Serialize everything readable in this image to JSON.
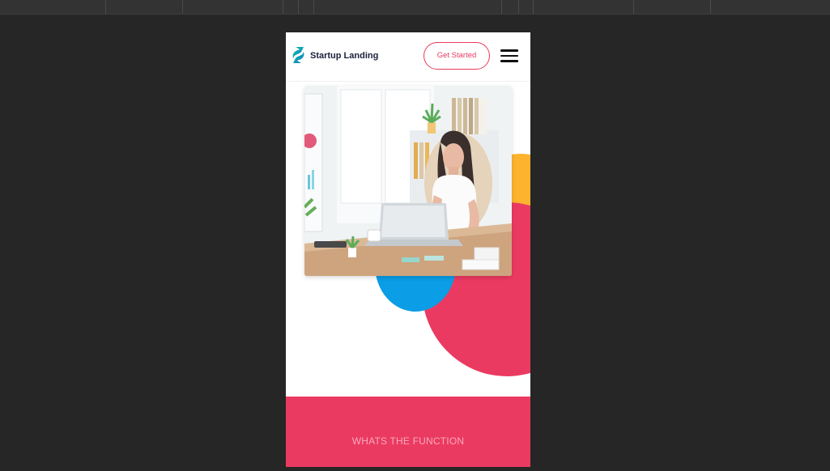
{
  "header": {
    "brand": "Startup Landing",
    "cta_label": "Get Started",
    "menu_icon": "hamburger-icon",
    "logo_icon": "startup-logo-icon"
  },
  "hero": {
    "image": "woman-working-on-laptop-at-office-desk"
  },
  "features": {
    "section_label": "WHATS THE FUNCTION"
  },
  "colors": {
    "accent": "#eb3a61",
    "yellow": "#fdb32d",
    "blue": "#0b9de5",
    "background": "#262626",
    "logo_teal": "#0fb3b5"
  }
}
